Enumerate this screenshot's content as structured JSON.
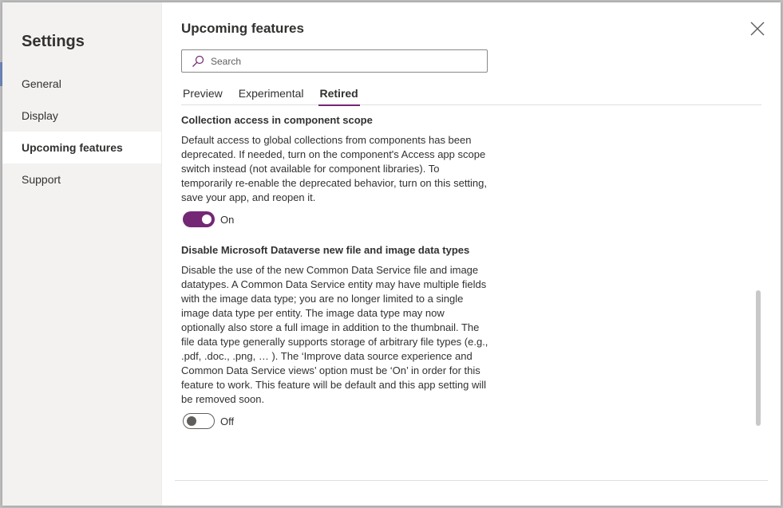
{
  "sidebar": {
    "title": "Settings",
    "items": [
      {
        "label": "General",
        "selected": false
      },
      {
        "label": "Display",
        "selected": false
      },
      {
        "label": "Upcoming features",
        "selected": true
      },
      {
        "label": "Support",
        "selected": false
      }
    ]
  },
  "main": {
    "title": "Upcoming features",
    "close_icon": "close-icon",
    "search": {
      "placeholder": "Search",
      "value": "",
      "icon": "search-icon"
    },
    "tabs": [
      {
        "label": "Preview",
        "active": false
      },
      {
        "label": "Experimental",
        "active": false
      },
      {
        "label": "Retired",
        "active": true
      }
    ],
    "features": [
      {
        "title": "Collection access in component scope",
        "description": "Default access to global collections from components has been deprecated. If needed, turn on the component's Access app scope switch instead (not available for component libraries). To temporarily re-enable the deprecated behavior, turn on this setting, save your app, and reopen it.",
        "toggle_state": "on",
        "toggle_label": "On"
      },
      {
        "title": "Disable Microsoft Dataverse new file and image data types",
        "description": "Disable the use of the new Common Data Service file and image datatypes. A Common Data Service entity may have multiple fields with the image data type; you are no longer limited to a single image data type per entity. The image data type may now optionally also store a full image in addition to the thumbnail. The file data type generally supports storage of arbitrary file types (e.g., .pdf, .doc., .png, … ). The ‘Improve data source experience and Common Data Service views’ option must be ‘On’ in order for this feature to work. This feature will be default and this app setting will be removed soon.",
        "toggle_state": "off",
        "toggle_label": "Off"
      }
    ]
  },
  "colors": {
    "accent": "#742774",
    "sidebar_bg": "#f3f2f1",
    "text": "#323130"
  }
}
